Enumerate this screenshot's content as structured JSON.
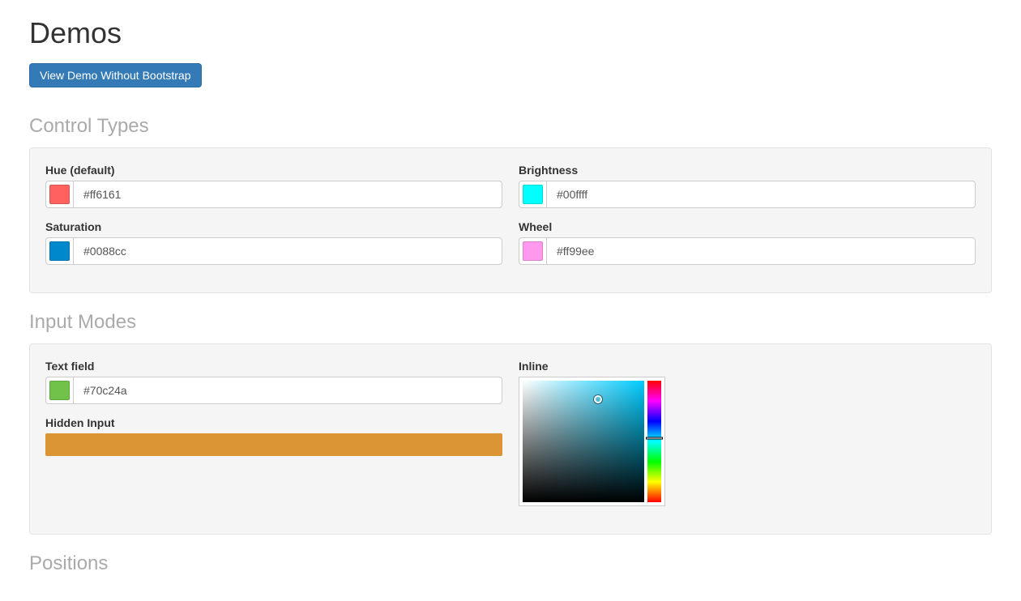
{
  "page": {
    "title": "Demos",
    "button_label": "View Demo Without Bootstrap"
  },
  "sections": {
    "control_types": {
      "heading": "Control Types",
      "hue": {
        "label": "Hue (default)",
        "value": "#ff6161",
        "swatch": "#ff6161"
      },
      "brightness": {
        "label": "Brightness",
        "value": "#00ffff",
        "swatch": "#00ffff"
      },
      "saturation": {
        "label": "Saturation",
        "value": "#0088cc",
        "swatch": "#0088cc"
      },
      "wheel": {
        "label": "Wheel",
        "value": "#ff99ee",
        "swatch": "#ff99ee"
      }
    },
    "input_modes": {
      "heading": "Input Modes",
      "text_field": {
        "label": "Text field",
        "value": "#70c24a",
        "swatch": "#70c24a"
      },
      "hidden_input": {
        "label": "Hidden Input",
        "bar_color": "#db9534"
      },
      "inline": {
        "label": "Inline",
        "base_hue": "#00ccff",
        "indicator_x": "62%",
        "indicator_y": "15%",
        "hue_pos": "47%"
      }
    },
    "positions": {
      "heading": "Positions"
    }
  }
}
